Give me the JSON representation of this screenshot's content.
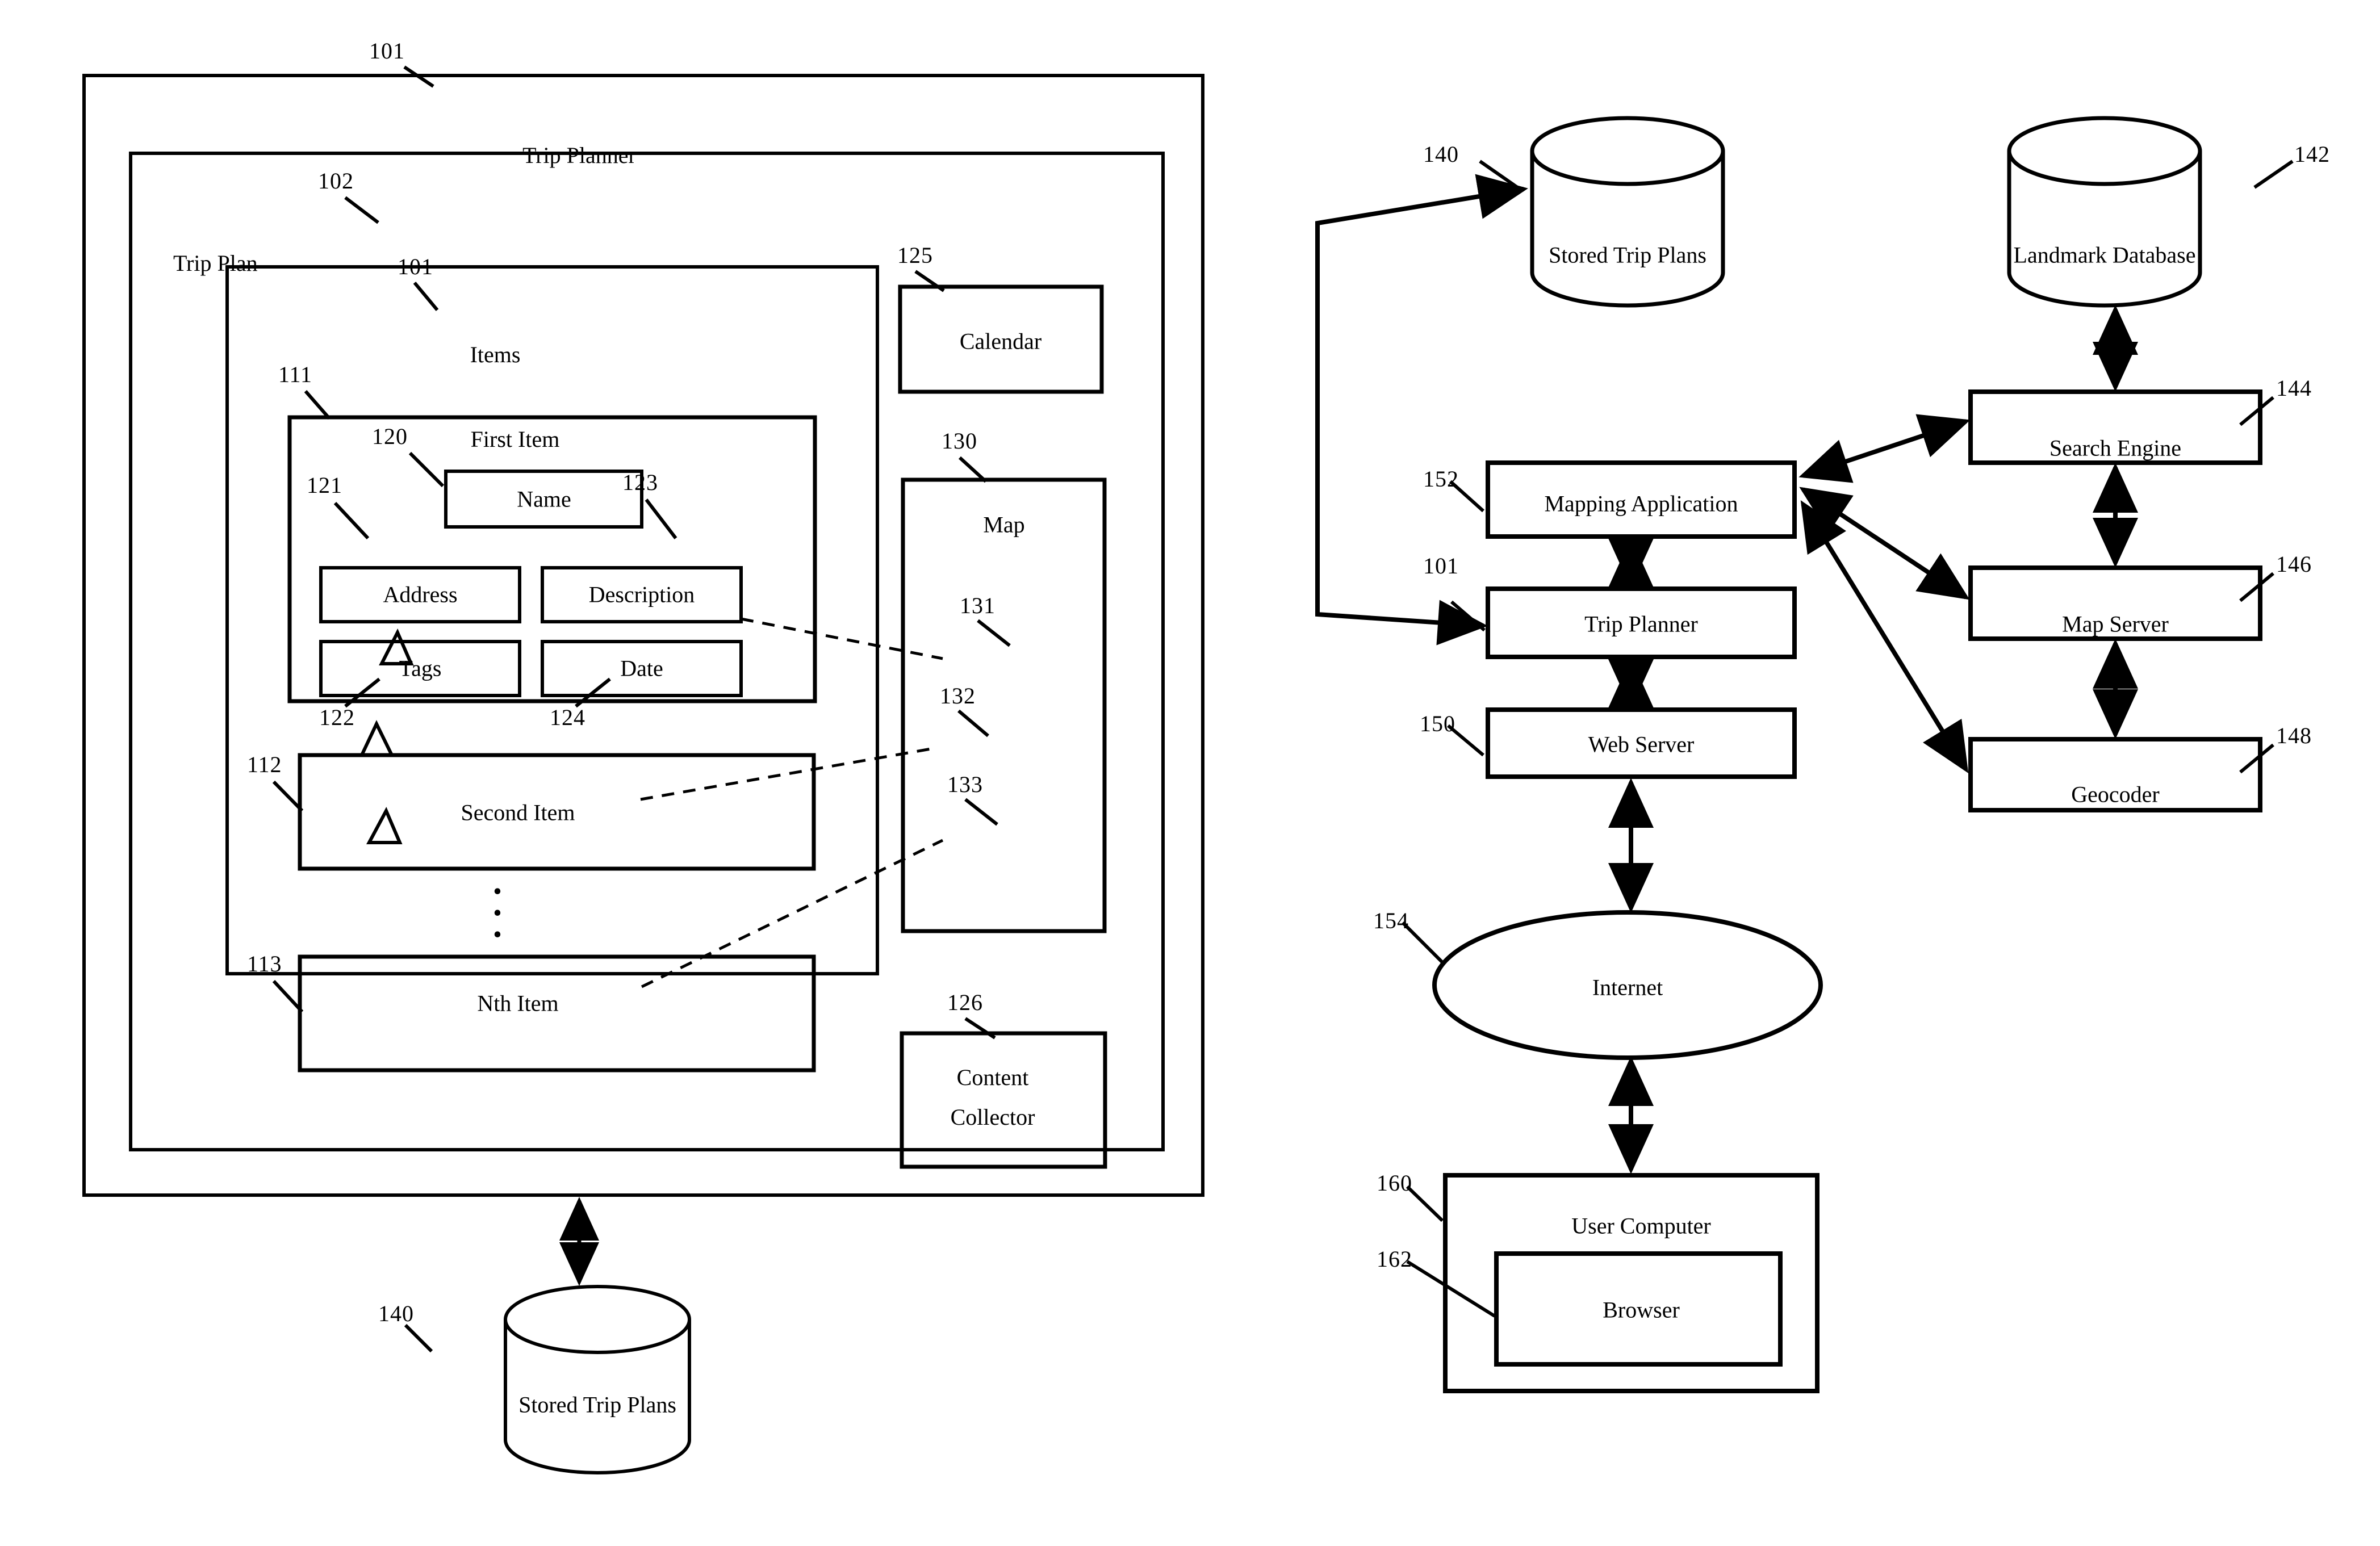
{
  "figure_left": {
    "outer_box_label": "Trip Planner",
    "outer_box_ref": "101",
    "trip_plan_label": "Trip Plan",
    "trip_plan_ref": "102",
    "items_label": "Items",
    "items_ref": "101",
    "first_item_label": "First Item",
    "first_item_ref": "111",
    "fields": [
      {
        "label": "Name",
        "ref": "120"
      },
      {
        "label": "Address",
        "ref": "121"
      },
      {
        "label": "Description",
        "ref": "123"
      },
      {
        "label": "Tags",
        "ref": "122"
      },
      {
        "label": "Date",
        "ref": "124"
      }
    ],
    "second_item_label": "Second Item",
    "second_item_ref": "112",
    "nth_item_label": "Nth Item",
    "nth_item_ref": "113",
    "ellipsis": "•",
    "calendar_label": "Calendar",
    "calendar_ref": "125",
    "map_label": "Map",
    "map_ref": "130",
    "map_markers": [
      {
        "ref": "131"
      },
      {
        "ref": "132"
      },
      {
        "ref": "133"
      }
    ],
    "content_collector_label": "Content\nCollector",
    "content_collector_line1": "Content",
    "content_collector_line2": "Collector",
    "content_collector_ref": "126",
    "stored_trip_plans_label": "Stored Trip Plans",
    "stored_trip_plans_ref": "140"
  },
  "figure_right": {
    "stored_trip_plans_label": "Stored Trip Plans",
    "stored_trip_plans_ref": "140",
    "landmark_database_label": "Landmark Database",
    "landmark_database_ref": "142",
    "mapping_application_label": "Mapping Application",
    "mapping_application_ref": "152",
    "trip_planner_label": "Trip Planner",
    "trip_planner_ref": "101",
    "web_server_label": "Web Server",
    "web_server_ref": "150",
    "search_engine_label": "Search Engine",
    "search_engine_ref": "144",
    "map_server_label": "Map Server",
    "map_server_ref": "146",
    "geocoder_label": "Geocoder",
    "geocoder_ref": "148",
    "internet_label": "Internet",
    "internet_ref": "154",
    "user_computer_label": "User Computer",
    "user_computer_ref": "160",
    "browser_label": "Browser",
    "browser_ref": "162"
  },
  "style": {
    "line_color": "#000000",
    "background": "#ffffff"
  }
}
